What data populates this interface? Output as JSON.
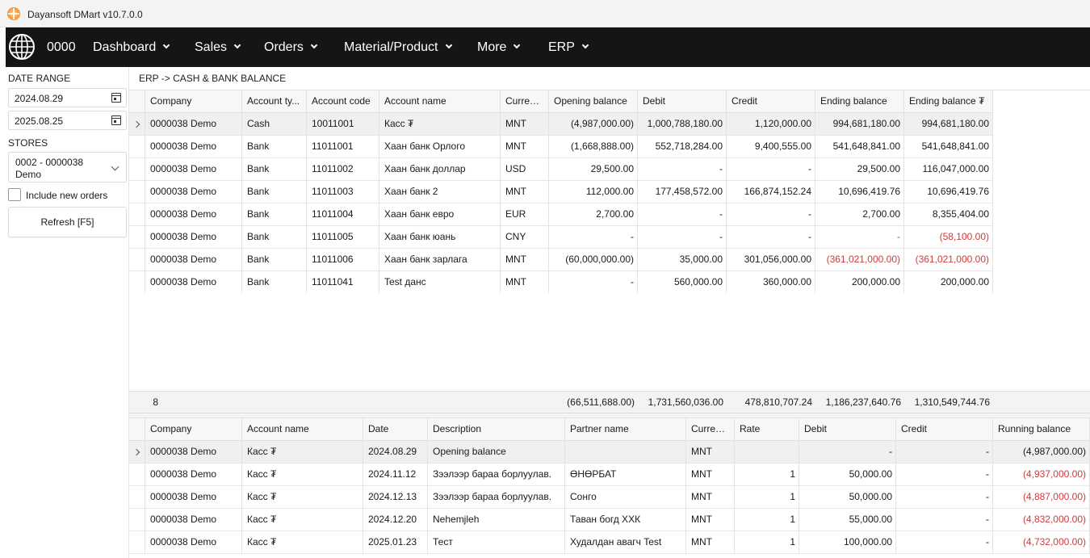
{
  "window": {
    "title": "Dayansoft DMart v10.7.0.0"
  },
  "menubar": {
    "store_code": "0000",
    "items": [
      {
        "label": "Dashboard"
      },
      {
        "label": "Sales"
      },
      {
        "label": "Orders"
      },
      {
        "label": "Material/Product"
      },
      {
        "label": "More"
      },
      {
        "label": "ERP"
      }
    ]
  },
  "sidebar": {
    "date_range_label": "DATE RANGE",
    "date_from": "2024.08.29",
    "date_to": "2025.08.25",
    "stores_label": "STORES",
    "store_selected": "0002 - 0000038 Demo",
    "include_new_orders_label": "Include new orders",
    "include_new_orders_checked": false,
    "refresh_label": "Refresh [F5]"
  },
  "breadcrumb": "ERP -> CASH & BANK BALANCE",
  "balance_grid": {
    "columns": [
      "Company",
      "Account ty...",
      "Account code",
      "Account name",
      "Currency",
      "Opening balance",
      "Debit",
      "Credit",
      "Ending balance",
      "Ending balance ₮"
    ],
    "rows": [
      [
        "0000038 Demo",
        "Cash",
        "10011001",
        "Касс ₮",
        "MNT",
        "(4,987,000.00)",
        "1,000,788,180.00",
        "1,120,000.00",
        "994,681,180.00",
        "994,681,180.00"
      ],
      [
        "0000038 Demo",
        "Bank",
        "11011001",
        "Хаан банк Орлого",
        "MNT",
        "(1,668,888.00)",
        "552,718,284.00",
        "9,400,555.00",
        "541,648,841.00",
        "541,648,841.00"
      ],
      [
        "0000038 Demo",
        "Bank",
        "11011002",
        "Хаан банк доллар",
        "USD",
        "29,500.00",
        "-",
        "-",
        "29,500.00",
        "116,047,000.00"
      ],
      [
        "0000038 Demo",
        "Bank",
        "11011003",
        "Хаан банк 2",
        "MNT",
        "112,000.00",
        "177,458,572.00",
        "166,874,152.24",
        "10,696,419.76",
        "10,696,419.76"
      ],
      [
        "0000038 Demo",
        "Bank",
        "11011004",
        "Хаан банк евро",
        "EUR",
        "2,700.00",
        "-",
        "-",
        "2,700.00",
        "8,355,404.00"
      ],
      [
        "0000038 Demo",
        "Bank",
        "11011005",
        "Хаан банк юань",
        "CNY",
        "-",
        "-",
        "-",
        "-",
        "(58,100.00)"
      ],
      [
        "0000038 Demo",
        "Bank",
        "11011006",
        "Хаан банк зарлага",
        "MNT",
        "(60,000,000.00)",
        "35,000.00",
        "301,056,000.00",
        "(361,021,000.00)",
        "(361,021,000.00)"
      ],
      [
        "0000038 Demo",
        "Bank",
        "11011041",
        "Test данс",
        "MNT",
        "-",
        "560,000.00",
        "360,000.00",
        "200,000.00",
        "200,000.00"
      ]
    ],
    "negative_cells": [
      [
        8,
        5
      ],
      [
        8,
        9
      ],
      [
        9,
        9
      ],
      [
        9,
        6
      ],
      [
        8,
        6
      ]
    ],
    "totals": {
      "count": "8",
      "opening": "(66,511,688.00)",
      "debit": "1,731,560,036.00",
      "credit": "478,810,707.24",
      "ending": "1,186,237,640.76",
      "ending_mnt": "1,310,549,744.76"
    }
  },
  "detail_grid": {
    "columns": [
      "Company",
      "Account name",
      "Date",
      "Description",
      "Partner name",
      "Currency",
      "Rate",
      "Debit",
      "Credit",
      "Running balance"
    ],
    "rows": [
      [
        "0000038 Demo",
        "Касс ₮",
        "2024.08.29",
        "Opening balance",
        "",
        "MNT",
        "",
        "-",
        "-",
        "(4,987,000.00)"
      ],
      [
        "0000038 Demo",
        "Касс ₮",
        "2024.11.12",
        "Зээлээр бараа борлуулав.",
        "ӨНӨРБАТ",
        "MNT",
        "1",
        "50,000.00",
        "-",
        "(4,937,000.00)"
      ],
      [
        "0000038 Demo",
        "Касс ₮",
        "2024.12.13",
        "Зээлээр бараа борлуулав.",
        "Сонго",
        "MNT",
        "1",
        "50,000.00",
        "-",
        "(4,887,000.00)"
      ],
      [
        "0000038 Demo",
        "Касс ₮",
        "2024.12.20",
        "Nehemjleh",
        "Таван богд ХХК",
        "MNT",
        "1",
        "55,000.00",
        "-",
        "(4,832,000.00)"
      ],
      [
        "0000038 Demo",
        "Касс ₮",
        "2025.01.23",
        "Тест",
        "Худалдан авагч Test",
        "MNT",
        "1",
        "100,000.00",
        "-",
        "(4,732,000.00)"
      ]
    ]
  },
  "colors": {
    "negative": "#d13a3a",
    "menubar": "#151515",
    "accent": "#f39a3c"
  }
}
